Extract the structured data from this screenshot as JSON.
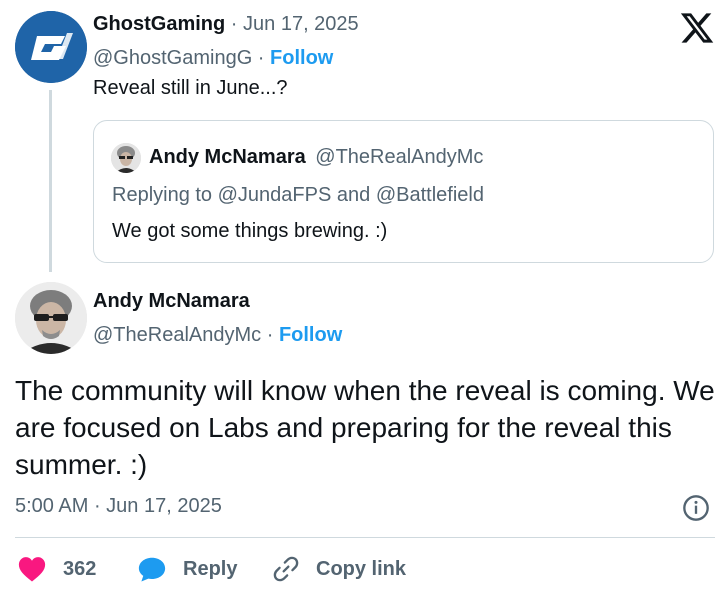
{
  "parent": {
    "name": "GhostGaming",
    "date": "Jun 17, 2025",
    "handle": "@GhostGamingG",
    "follow_label": "Follow",
    "text": "Reveal still in June...?"
  },
  "quoted": {
    "name": "Andy McNamara",
    "handle": "@TheRealAndyMc",
    "replying_prefix": "Replying to",
    "reply_to_1": "@JundaFPS",
    "reply_and": "and",
    "reply_to_2": "@Battlefield",
    "text": "We got some things brewing. :)"
  },
  "main": {
    "name": "Andy McNamara",
    "handle": "@TheRealAndyMc",
    "follow_label": "Follow",
    "text": "The community will know when the reveal is coming. We are focused on Labs and preparing for the reveal this summer. :)",
    "time": "5:00 AM",
    "date": "Jun 17, 2025"
  },
  "actions": {
    "likes": "362",
    "reply_label": "Reply",
    "copy_label": "Copy link"
  },
  "colors": {
    "accent": "#1d9bf0",
    "like": "#f91880",
    "muted": "#536471"
  }
}
